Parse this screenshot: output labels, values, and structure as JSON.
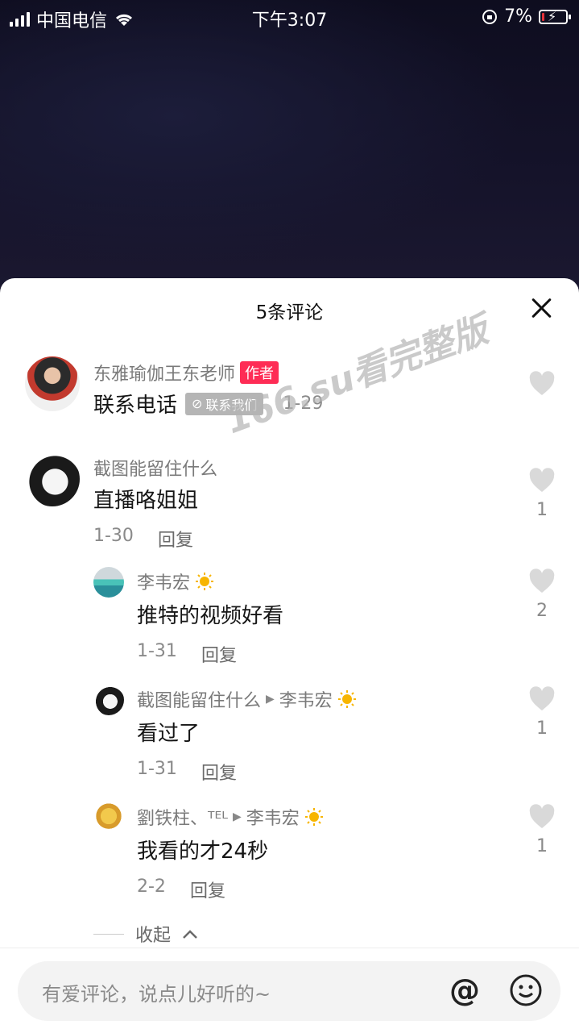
{
  "status_bar": {
    "carrier": "中国电信",
    "time": "下午3:07",
    "battery": "7%"
  },
  "sheet": {
    "title": "5条评论",
    "comments": [
      {
        "name": "东雅瑜伽王东老师",
        "badge": "作者",
        "text": "联系电话",
        "tag": "联系我们",
        "date": "1-29",
        "likes": ""
      },
      {
        "name": "截图能留住什么",
        "text": "直播咯姐姐",
        "date": "1-30",
        "reply_label": "回复",
        "likes": "1"
      }
    ],
    "replies": [
      {
        "name": "李韦宏",
        "text": "推特的视频好看",
        "date": "1-31",
        "reply_label": "回复",
        "likes": "2"
      },
      {
        "name": "截图能留住什么",
        "reply_to": "李韦宏",
        "text": "看过了",
        "date": "1-31",
        "reply_label": "回复",
        "likes": "1"
      },
      {
        "name": "劉铁柱、ᵀᴱᴸ",
        "reply_to": "李韦宏",
        "text": "我看的才24秒",
        "date": "2-2",
        "reply_label": "回复",
        "likes": "1"
      }
    ],
    "collapse_label": "收起"
  },
  "input": {
    "placeholder": "有爱评论，说点儿好听的~",
    "at_symbol": "@"
  },
  "watermark": "166.su看完整版",
  "icons": [
    "wifi-icon",
    "rotation-lock-icon",
    "battery-icon",
    "close-icon",
    "heart-icon",
    "sun-icon",
    "link-icon",
    "at-icon",
    "emoji-icon",
    "chevron-up-icon"
  ]
}
